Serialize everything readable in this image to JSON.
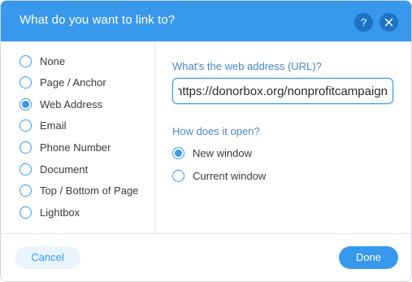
{
  "dialog": {
    "title": "What do you want to link to?",
    "help_icon": "question-mark-icon",
    "close_icon": "close-icon"
  },
  "link_types": [
    {
      "label": "None",
      "selected": false
    },
    {
      "label": "Page / Anchor",
      "selected": false
    },
    {
      "label": "Web Address",
      "selected": true
    },
    {
      "label": "Email",
      "selected": false
    },
    {
      "label": "Phone Number",
      "selected": false
    },
    {
      "label": "Document",
      "selected": false
    },
    {
      "label": "Top / Bottom of Page",
      "selected": false
    },
    {
      "label": "Lightbox",
      "selected": false
    }
  ],
  "web_address": {
    "url_label": "What's the web address (URL)?",
    "url_value": "https://donorbox.org/nonprofitcampaign",
    "open_label": "How does it open?",
    "open_options": [
      {
        "label": "New window",
        "selected": true
      },
      {
        "label": "Current window",
        "selected": false
      }
    ]
  },
  "footer": {
    "cancel_label": "Cancel",
    "done_label": "Done"
  },
  "colors": {
    "accent": "#3899ec",
    "header_button": "#1e74c2",
    "field_label": "#4a87c5"
  }
}
